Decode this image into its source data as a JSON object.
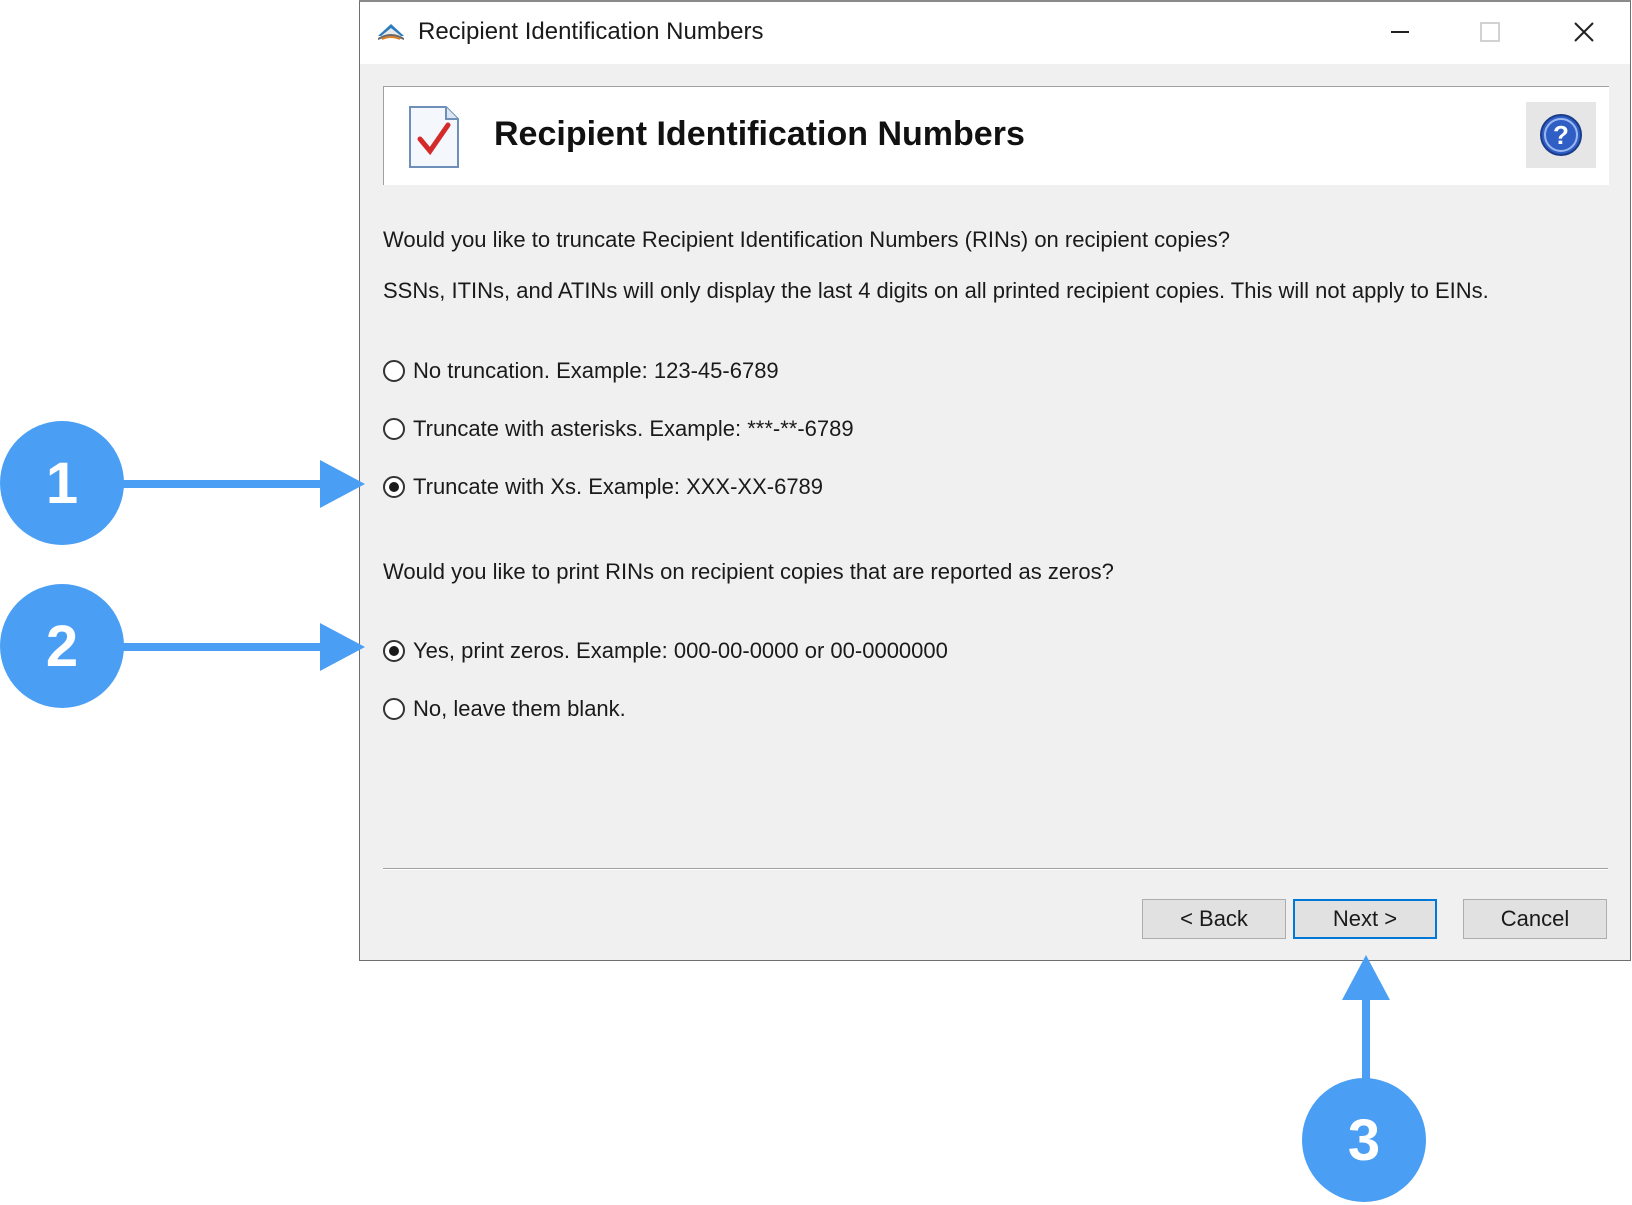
{
  "window": {
    "title": "Recipient Identification Numbers",
    "minimize_icon": "minimize-icon",
    "maximize_icon": "maximize-icon",
    "close_icon": "close-icon"
  },
  "header": {
    "title": "Recipient Identification Numbers",
    "doc_icon": "checklist-document-icon",
    "help_icon": "help-icon"
  },
  "content": {
    "question1": "Would you like to truncate Recipient Identification Numbers (RINs) on recipient copies?",
    "info1": "SSNs, ITINs, and ATINs will only display the last 4 digits on all printed recipient copies. This will not apply to EINs.",
    "truncation_options": [
      {
        "label": "No truncation. Example: 123-45-6789",
        "checked": false
      },
      {
        "label": "Truncate with asterisks. Example: ***-**-6789",
        "checked": false
      },
      {
        "label": "Truncate with Xs. Example: XXX-XX-6789",
        "checked": true
      }
    ],
    "question2": "Would you like to print RINs on recipient copies that are reported as zeros?",
    "zero_options": [
      {
        "label": "Yes, print zeros. Example: 000-00-0000 or 00-0000000",
        "checked": true
      },
      {
        "label": "No, leave them blank.",
        "checked": false
      }
    ]
  },
  "buttons": {
    "back": "< Back",
    "next": "Next >",
    "cancel": "Cancel"
  },
  "annotations": {
    "color": "#4a9ff5",
    "badge1": "1",
    "badge2": "2",
    "badge3": "3"
  }
}
